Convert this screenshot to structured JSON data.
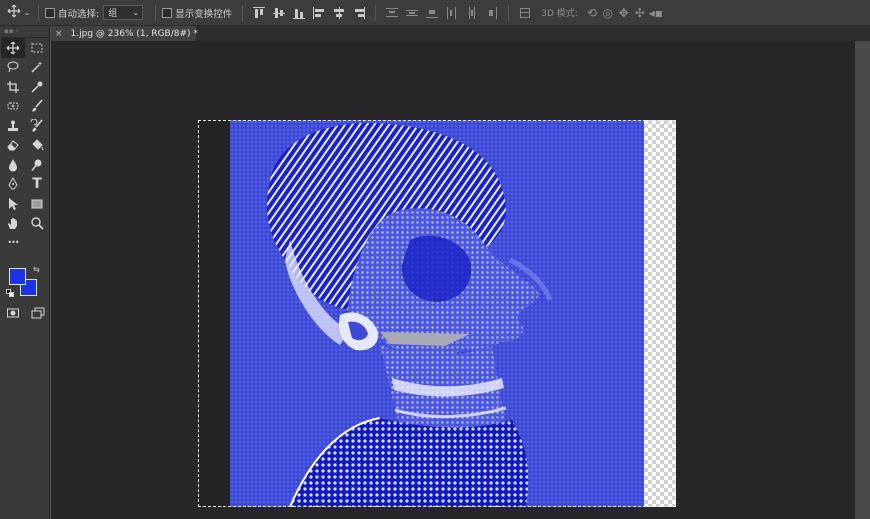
{
  "options_bar": {
    "move_tool_icon": "move-arrows-icon",
    "auto_select_label": "自动选择:",
    "auto_select_value": "组",
    "show_transform_label": "显示变换控件",
    "mode_3d_label": "3D 模式:"
  },
  "document": {
    "tab_title": "1.jpg @ 236% (1, RGB/8#) *",
    "close_glyph": "×"
  },
  "tools": [
    "move-icon",
    "marquee-icon",
    "lasso-icon",
    "magic-wand-icon",
    "crop-icon",
    "eyedropper-icon",
    "healing-icon",
    "brush-icon",
    "stamp-icon",
    "history-brush-icon",
    "eraser-icon",
    "paint-bucket-icon",
    "blur-icon",
    "dodge-icon",
    "pen-icon",
    "type-icon",
    "path-select-icon",
    "rectangle-icon",
    "hand-icon",
    "zoom-icon"
  ],
  "type_tool_glyph": "T",
  "more_tools_glyph": "•••",
  "colors": {
    "foreground": "#1a32e6",
    "background": "#1a32e6",
    "image_blue": "#3d4ad8"
  }
}
